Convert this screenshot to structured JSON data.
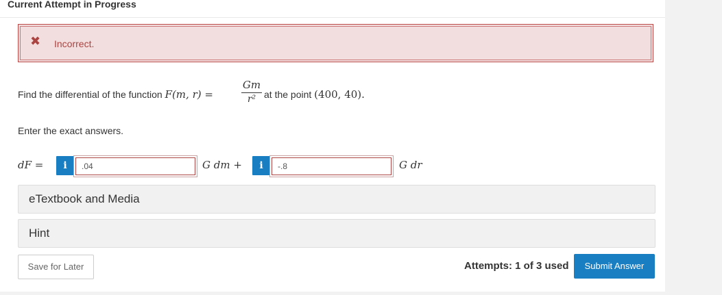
{
  "header": {
    "title": "Current Attempt in Progress"
  },
  "alert": {
    "icon": "✖",
    "text": "Incorrect."
  },
  "question": {
    "prefix": "Find the differential of the function",
    "function_lhs": "F(m, r) =",
    "frac_num": "Gm",
    "frac_den": "r²",
    "suffix": "at the point",
    "point": "(400, 40)."
  },
  "instructions": "Enter the exact answers.",
  "answers": {
    "df_label": "dF =",
    "info_icon": "i",
    "answer1_value": ".04",
    "mid_text": "G dm +",
    "answer2_value": "-.8",
    "end_text": "G dr"
  },
  "accordions": {
    "etextbook": "eTextbook and Media",
    "hint": "Hint"
  },
  "footer": {
    "save_label": "Save for Later",
    "attempts": "Attempts: 1 of 3 used",
    "submit_label": "Submit Answer"
  },
  "colors": {
    "accent": "#1a7ec2",
    "error_bg": "#f2dede",
    "error_text": "#a94442"
  }
}
